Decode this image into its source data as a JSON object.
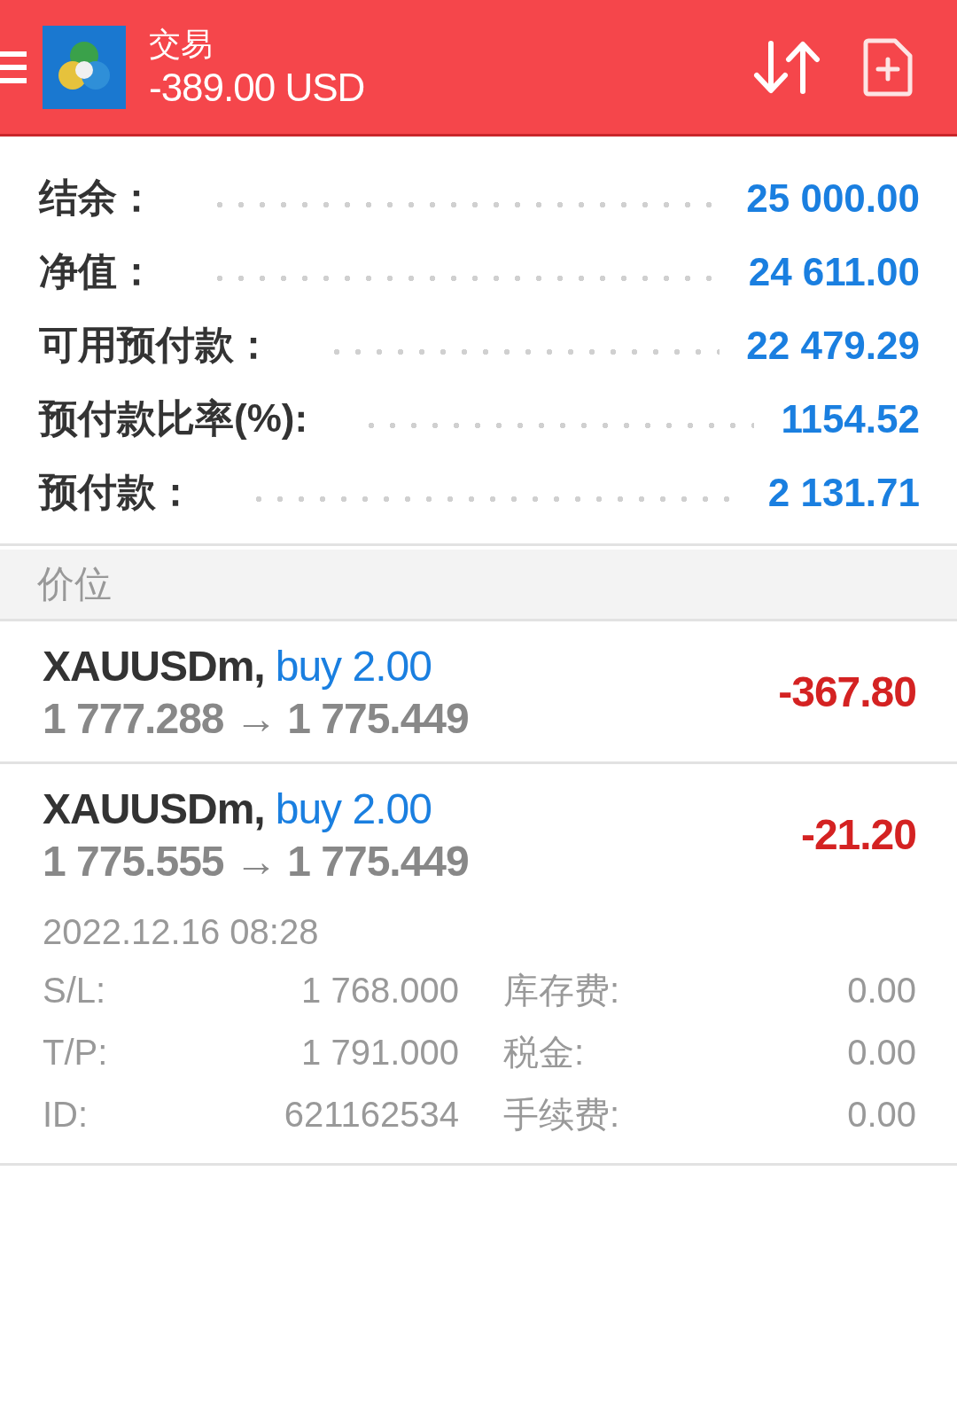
{
  "header": {
    "title": "交易",
    "balance": "-389.00 USD"
  },
  "summary": [
    {
      "label": "结余：",
      "value": "25 000.00"
    },
    {
      "label": "净值：",
      "value": "24 611.00"
    },
    {
      "label": "可用预付款：",
      "value": "22 479.29"
    },
    {
      "label": "预付款比率(%):",
      "value": "1154.52"
    },
    {
      "label": "预付款：",
      "value": "2 131.71"
    }
  ],
  "section": {
    "title": "价位"
  },
  "positions": [
    {
      "symbol": "XAUUSDm,",
      "side": "buy 2.00",
      "prices": "1 777.288 → 1 775.449",
      "profit": "-367.80",
      "negative": true,
      "expanded": false
    },
    {
      "symbol": "XAUUSDm,",
      "side": "buy 2.00",
      "prices": "1 775.555 → 1 775.449",
      "profit": "-21.20",
      "negative": true,
      "expanded": true,
      "details": {
        "time": "2022.12.16 08:28",
        "rows": [
          {
            "label": "S/L:",
            "value": "1 768.000",
            "label2": "库存费:",
            "value2": "0.00"
          },
          {
            "label": "T/P:",
            "value": "1 791.000",
            "label2": "税金:",
            "value2": "0.00"
          },
          {
            "label": "ID:",
            "value": "621162534",
            "label2": "手续费:",
            "value2": "0.00"
          }
        ]
      }
    }
  ]
}
